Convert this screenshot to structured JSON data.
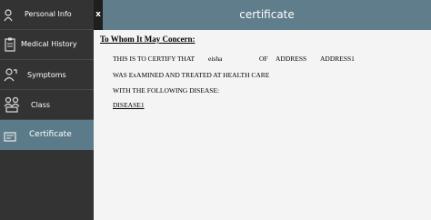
{
  "sidebar": {
    "items": [
      {
        "label": "Personal Info",
        "icon": "person-icon"
      },
      {
        "label": "Medical History",
        "icon": "clipboard-icon"
      },
      {
        "label": "Symptoms",
        "icon": "symptoms-icon"
      },
      {
        "label": "Class",
        "icon": "class-icon"
      },
      {
        "label": "Certificate",
        "icon": "certificate-icon"
      }
    ],
    "active_index": 4
  },
  "close_label": "x",
  "header": {
    "title": "certificate"
  },
  "certificate": {
    "salutation": "To Whom It May Concern:",
    "certify_prefix": "THIS IS TO CERTIFY THAT",
    "patient_name": "eisha",
    "of_label": "OF",
    "address_label": "ADDRESS",
    "address_value": "ADDRESS1",
    "line2": "WAS ExAMINED AND TREATED AT HEALTH CARE",
    "line3": "WITH THE FOLLOWING DISEASE:",
    "disease": "DISEASE1"
  },
  "colors": {
    "sidebar_bg": "#333333",
    "active_item_bg": "#5b7b8b",
    "header_bg": "#607d8b",
    "content_bg": "#f4f4f4"
  }
}
